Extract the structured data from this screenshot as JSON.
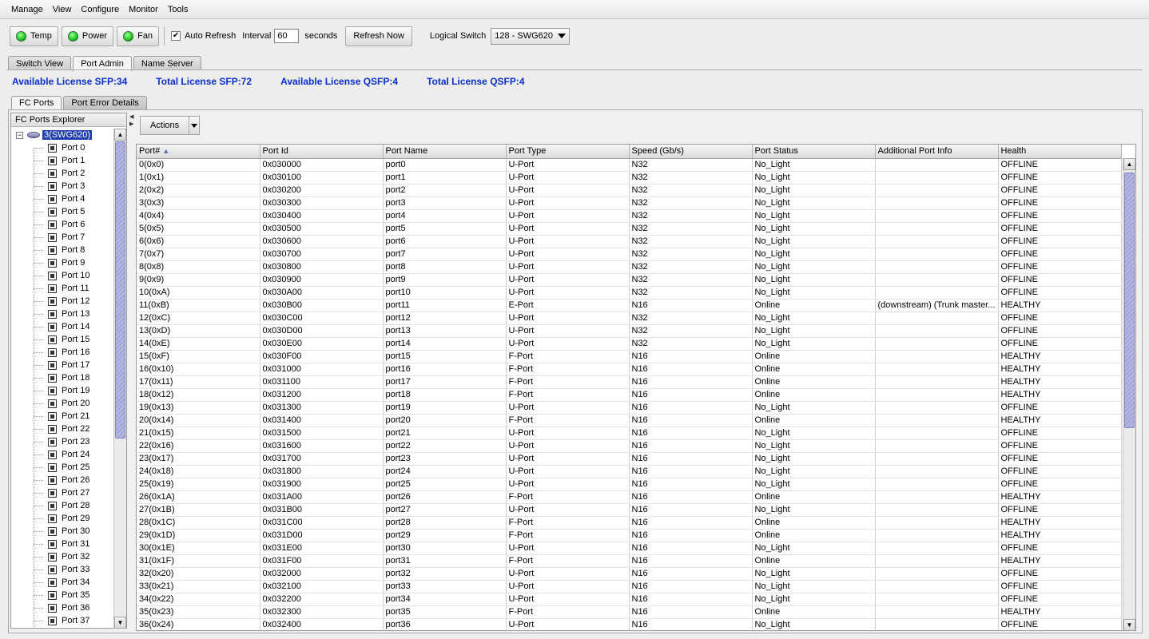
{
  "menu": [
    {
      "label": "Manage",
      "key": "M"
    },
    {
      "label": "View",
      "key": "V"
    },
    {
      "label": "Configure",
      "key": "C"
    },
    {
      "label": "Monitor",
      "key": "o"
    },
    {
      "label": "Tools",
      "key": "T"
    }
  ],
  "toolbar": {
    "temp": "Temp",
    "power": "Power",
    "fan": "Fan",
    "auto_refresh": "Auto Refresh",
    "auto_refresh_checked": "✔",
    "interval_label": "Interval",
    "interval_value": "60",
    "seconds": "seconds",
    "refresh_now": "Refresh Now",
    "logical_switch_label": "Logical Switch",
    "logical_switch_value": "128 - SWG620",
    "led_color": "#1ec51e"
  },
  "tabs": [
    "Switch View",
    "Port Admin",
    "Name Server"
  ],
  "active_tab": "Port Admin",
  "license": {
    "available_sfp": "Available License SFP:34",
    "total_sfp": "Total License SFP:72",
    "available_qsfp": "Available License QSFP:4",
    "total_qsfp": "Total License QSFP:4",
    "color": "#0a2fd1"
  },
  "subtabs": [
    "FC Ports",
    "Port Error Details"
  ],
  "explorer": {
    "title": "FC Ports Explorer",
    "root": "3(SWG620)",
    "items": [
      "Port 0",
      "Port 1",
      "Port 2",
      "Port 3",
      "Port 4",
      "Port 5",
      "Port 6",
      "Port 7",
      "Port 8",
      "Port 9",
      "Port 10",
      "Port 11",
      "Port 12",
      "Port 13",
      "Port 14",
      "Port 15",
      "Port 16",
      "Port 17",
      "Port 18",
      "Port 19",
      "Port 20",
      "Port 21",
      "Port 22",
      "Port 23",
      "Port 24",
      "Port 25",
      "Port 26",
      "Port 27",
      "Port 28",
      "Port 29",
      "Port 30",
      "Port 31",
      "Port 32",
      "Port 33",
      "Port 34",
      "Port 35",
      "Port 36",
      "Port 37"
    ]
  },
  "actions_label": "Actions",
  "table": {
    "columns": [
      "Port#",
      "Port Id",
      "Port Name",
      "Port Type",
      "Speed (Gb/s)",
      "Port Status",
      "Additional Port Info",
      "Health"
    ],
    "rows": [
      [
        "0(0x0)",
        "0x030000",
        "port0",
        "U-Port",
        "N32",
        "No_Light",
        "",
        "OFFLINE"
      ],
      [
        "1(0x1)",
        "0x030100",
        "port1",
        "U-Port",
        "N32",
        "No_Light",
        "",
        "OFFLINE"
      ],
      [
        "2(0x2)",
        "0x030200",
        "port2",
        "U-Port",
        "N32",
        "No_Light",
        "",
        "OFFLINE"
      ],
      [
        "3(0x3)",
        "0x030300",
        "port3",
        "U-Port",
        "N32",
        "No_Light",
        "",
        "OFFLINE"
      ],
      [
        "4(0x4)",
        "0x030400",
        "port4",
        "U-Port",
        "N32",
        "No_Light",
        "",
        "OFFLINE"
      ],
      [
        "5(0x5)",
        "0x030500",
        "port5",
        "U-Port",
        "N32",
        "No_Light",
        "",
        "OFFLINE"
      ],
      [
        "6(0x6)",
        "0x030600",
        "port6",
        "U-Port",
        "N32",
        "No_Light",
        "",
        "OFFLINE"
      ],
      [
        "7(0x7)",
        "0x030700",
        "port7",
        "U-Port",
        "N32",
        "No_Light",
        "",
        "OFFLINE"
      ],
      [
        "8(0x8)",
        "0x030800",
        "port8",
        "U-Port",
        "N32",
        "No_Light",
        "",
        "OFFLINE"
      ],
      [
        "9(0x9)",
        "0x030900",
        "port9",
        "U-Port",
        "N32",
        "No_Light",
        "",
        "OFFLINE"
      ],
      [
        "10(0xA)",
        "0x030A00",
        "port10",
        "U-Port",
        "N32",
        "No_Light",
        "",
        "OFFLINE"
      ],
      [
        "11(0xB)",
        "0x030B00",
        "port11",
        "E-Port",
        "N16",
        "Online",
        "(downstream) (Trunk master...",
        "HEALTHY"
      ],
      [
        "12(0xC)",
        "0x030C00",
        "port12",
        "U-Port",
        "N32",
        "No_Light",
        "",
        "OFFLINE"
      ],
      [
        "13(0xD)",
        "0x030D00",
        "port13",
        "U-Port",
        "N32",
        "No_Light",
        "",
        "OFFLINE"
      ],
      [
        "14(0xE)",
        "0x030E00",
        "port14",
        "U-Port",
        "N32",
        "No_Light",
        "",
        "OFFLINE"
      ],
      [
        "15(0xF)",
        "0x030F00",
        "port15",
        "F-Port",
        "N16",
        "Online",
        "",
        "HEALTHY"
      ],
      [
        "16(0x10)",
        "0x031000",
        "port16",
        "F-Port",
        "N16",
        "Online",
        "",
        "HEALTHY"
      ],
      [
        "17(0x11)",
        "0x031100",
        "port17",
        "F-Port",
        "N16",
        "Online",
        "",
        "HEALTHY"
      ],
      [
        "18(0x12)",
        "0x031200",
        "port18",
        "F-Port",
        "N16",
        "Online",
        "",
        "HEALTHY"
      ],
      [
        "19(0x13)",
        "0x031300",
        "port19",
        "U-Port",
        "N16",
        "No_Light",
        "",
        "OFFLINE"
      ],
      [
        "20(0x14)",
        "0x031400",
        "port20",
        "F-Port",
        "N16",
        "Online",
        "",
        "HEALTHY"
      ],
      [
        "21(0x15)",
        "0x031500",
        "port21",
        "U-Port",
        "N16",
        "No_Light",
        "",
        "OFFLINE"
      ],
      [
        "22(0x16)",
        "0x031600",
        "port22",
        "U-Port",
        "N16",
        "No_Light",
        "",
        "OFFLINE"
      ],
      [
        "23(0x17)",
        "0x031700",
        "port23",
        "U-Port",
        "N16",
        "No_Light",
        "",
        "OFFLINE"
      ],
      [
        "24(0x18)",
        "0x031800",
        "port24",
        "U-Port",
        "N16",
        "No_Light",
        "",
        "OFFLINE"
      ],
      [
        "25(0x19)",
        "0x031900",
        "port25",
        "U-Port",
        "N16",
        "No_Light",
        "",
        "OFFLINE"
      ],
      [
        "26(0x1A)",
        "0x031A00",
        "port26",
        "F-Port",
        "N16",
        "Online",
        "",
        "HEALTHY"
      ],
      [
        "27(0x1B)",
        "0x031B00",
        "port27",
        "U-Port",
        "N16",
        "No_Light",
        "",
        "OFFLINE"
      ],
      [
        "28(0x1C)",
        "0x031C00",
        "port28",
        "F-Port",
        "N16",
        "Online",
        "",
        "HEALTHY"
      ],
      [
        "29(0x1D)",
        "0x031D00",
        "port29",
        "F-Port",
        "N16",
        "Online",
        "",
        "HEALTHY"
      ],
      [
        "30(0x1E)",
        "0x031E00",
        "port30",
        "U-Port",
        "N16",
        "No_Light",
        "",
        "OFFLINE"
      ],
      [
        "31(0x1F)",
        "0x031F00",
        "port31",
        "F-Port",
        "N16",
        "Online",
        "",
        "HEALTHY"
      ],
      [
        "32(0x20)",
        "0x032000",
        "port32",
        "U-Port",
        "N16",
        "No_Light",
        "",
        "OFFLINE"
      ],
      [
        "33(0x21)",
        "0x032100",
        "port33",
        "U-Port",
        "N16",
        "No_Light",
        "",
        "OFFLINE"
      ],
      [
        "34(0x22)",
        "0x032200",
        "port34",
        "U-Port",
        "N16",
        "No_Light",
        "",
        "OFFLINE"
      ],
      [
        "35(0x23)",
        "0x032300",
        "port35",
        "F-Port",
        "N16",
        "Online",
        "",
        "HEALTHY"
      ],
      [
        "36(0x24)",
        "0x032400",
        "port36",
        "U-Port",
        "N16",
        "No_Light",
        "",
        "OFFLINE"
      ]
    ]
  }
}
